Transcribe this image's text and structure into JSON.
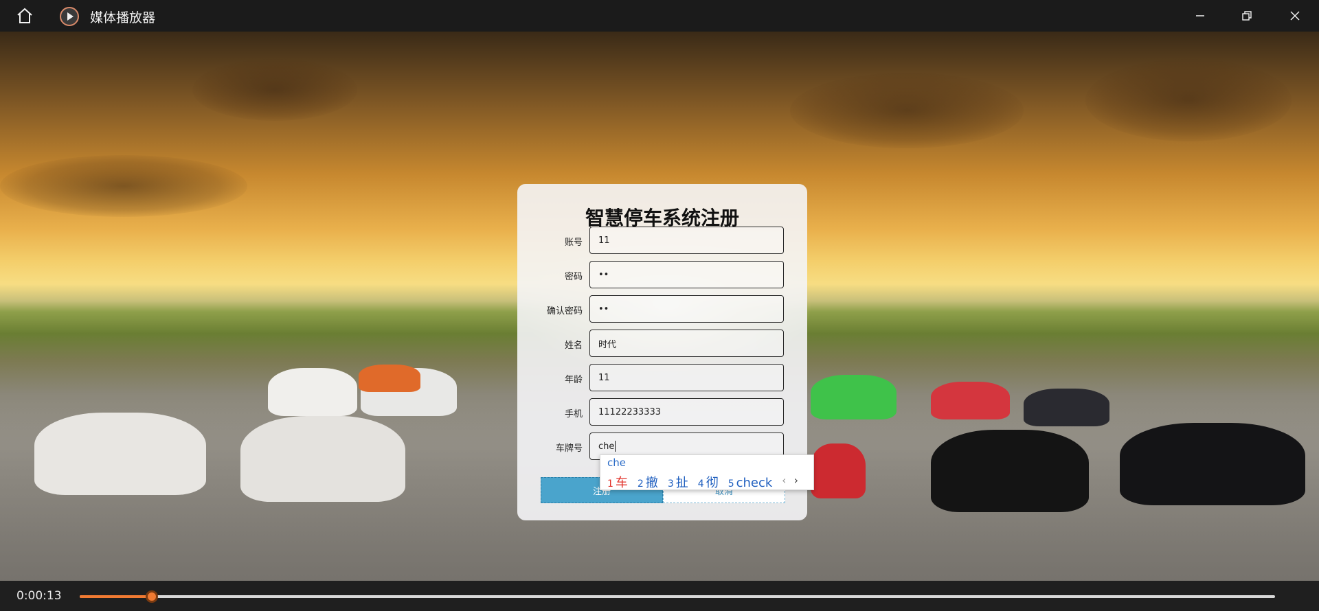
{
  "window": {
    "title": "媒体播放器",
    "icons": {
      "home": "home-icon",
      "app": "play-circle-icon",
      "minimize": "minimize-icon",
      "maximize": "restore-icon",
      "close": "close-icon"
    }
  },
  "form": {
    "title": "智慧停车系统注册",
    "fields": [
      {
        "label": "账号",
        "value": "11"
      },
      {
        "label": "密码",
        "value": "••"
      },
      {
        "label": "确认密码",
        "value": "••"
      },
      {
        "label": "姓名",
        "value": "时代"
      },
      {
        "label": "年龄",
        "value": "11"
      },
      {
        "label": "手机",
        "value": "11122233333"
      },
      {
        "label": "车牌号",
        "value": "che"
      }
    ],
    "register_label": "注册",
    "cancel_label": "取消"
  },
  "ime": {
    "composition": "che",
    "candidates": [
      {
        "num": "1",
        "text": "车"
      },
      {
        "num": "2",
        "text": "撤"
      },
      {
        "num": "3",
        "text": "扯"
      },
      {
        "num": "4",
        "text": "彻"
      },
      {
        "num": "5",
        "text": "check"
      }
    ],
    "prev": "‹",
    "next": "›"
  },
  "player": {
    "current_time": "0:00:13",
    "progress": 0.0605,
    "accent_color": "#f07a32"
  }
}
